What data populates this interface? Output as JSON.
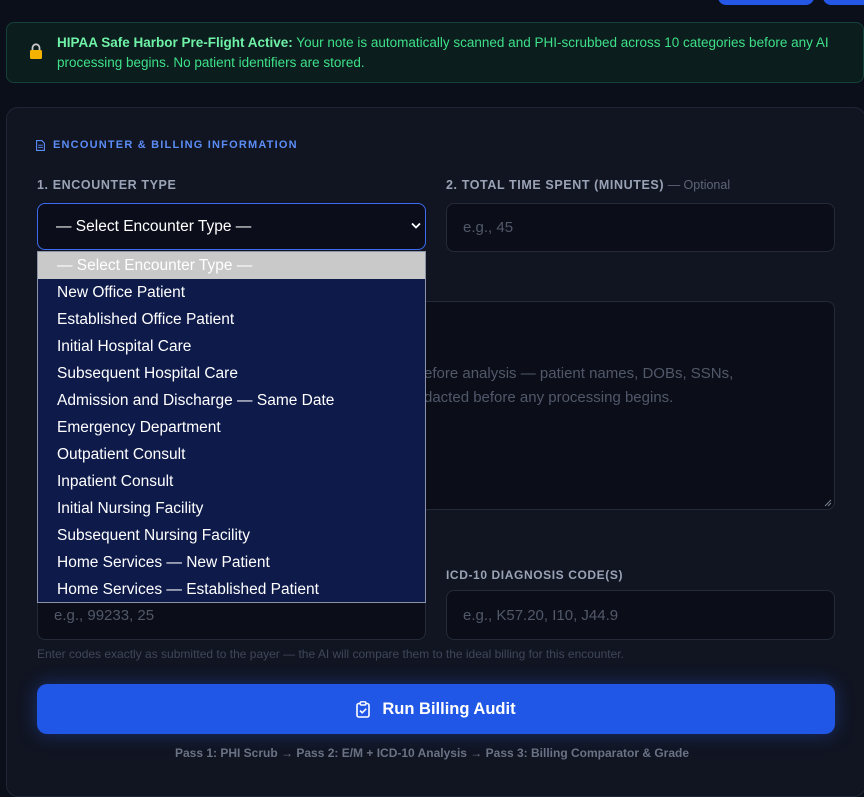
{
  "notice": {
    "title": "HIPAA Safe Harbor Pre-Flight Active:",
    "text": " Your note is automatically scanned and PHI-scrubbed across 10 categories before any AI processing begins. No patient identifiers are stored."
  },
  "section": {
    "title": "ENCOUNTER & BILLING INFORMATION"
  },
  "encounter": {
    "label": "1. ENCOUNTER TYPE",
    "selected": "— Select Encounter Type —",
    "options": [
      "— Select Encounter Type —",
      "New Office Patient",
      "Established Office Patient",
      "Initial Hospital Care",
      "Subsequent Hospital Care",
      "Admission and Discharge — Same Date",
      "Emergency Department",
      "Outpatient Consult",
      "Inpatient Consult",
      "Initial Nursing Facility",
      "Subsequent Nursing Facility",
      "Home Services — New Patient",
      "Home Services — Established Patient"
    ]
  },
  "time": {
    "label": "2. TOTAL TIME SPENT (MINUTES)",
    "optional": " — Optional",
    "placeholder": "e.g., 45"
  },
  "note": {
    "placeholder_line1": "efore analysis — patient names, DOBs, SSNs,",
    "placeholder_line2": "dacted before any processing begins."
  },
  "cpt": {
    "placeholder": "e.g., 99233, 25"
  },
  "icd": {
    "label": "ICD-10 DIAGNOSIS CODE(S)",
    "placeholder": "e.g., K57.20, I10, J44.9"
  },
  "hint": "Enter codes exactly as submitted to the payer — the AI will compare them to the ideal billing for this encounter.",
  "run_button": {
    "label": "Run Billing Audit"
  },
  "pipeline": "Pass 1: PHI Scrub → Pass 2: E/M + ICD-10 Analysis → Pass 3: Billing Comparator & Grade"
}
